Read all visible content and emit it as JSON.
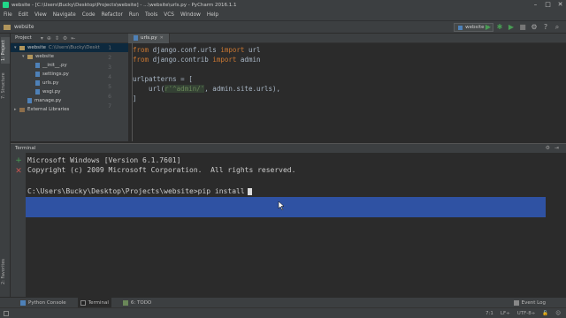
{
  "window": {
    "title": "website - [C:\\Users\\Bucky\\Desktop\\Projects\\website] - ...\\website\\urls.py - PyCharm 2016.1.1",
    "controls": [
      "–",
      "□",
      "✕"
    ]
  },
  "menu": [
    "File",
    "Edit",
    "View",
    "Navigate",
    "Code",
    "Refactor",
    "Run",
    "Tools",
    "VCS",
    "Window",
    "Help"
  ],
  "navbar": {
    "breadcrumb": "website",
    "run_config": "website",
    "accent": "#499c54"
  },
  "left_strip": {
    "tabs": [
      "1: Project",
      "7: Structure",
      "2: Favorites"
    ]
  },
  "project": {
    "header": "Project",
    "tree": [
      {
        "label": "website",
        "path": "C:\\Users\\Bucky\\Deskt",
        "type": "folder",
        "depth": 0,
        "expanded": true,
        "selected": true
      },
      {
        "label": "website",
        "path": "",
        "type": "folder",
        "depth": 1,
        "expanded": true,
        "selected": false
      },
      {
        "label": "__init__.py",
        "path": "",
        "type": "py",
        "depth": 2,
        "selected": false
      },
      {
        "label": "settings.py",
        "path": "",
        "type": "py",
        "depth": 2,
        "selected": false
      },
      {
        "label": "urls.py",
        "path": "",
        "type": "py",
        "depth": 2,
        "selected": false
      },
      {
        "label": "wsgi.py",
        "path": "",
        "type": "py",
        "depth": 2,
        "selected": false
      },
      {
        "label": "manage.py",
        "path": "",
        "type": "py",
        "depth": 1,
        "selected": false
      },
      {
        "label": "External Libraries",
        "path": "",
        "type": "libs",
        "depth": 0,
        "expanded": false,
        "selected": false
      }
    ]
  },
  "editor": {
    "tab": "urls.py",
    "line_numbers": [
      "1",
      "2",
      "3",
      "4",
      "5",
      "6",
      "7"
    ],
    "lines": [
      [
        {
          "t": "from",
          "c": "kw"
        },
        {
          "t": " django.conf.urls ",
          "c": "id"
        },
        {
          "t": "import",
          "c": "kw"
        },
        {
          "t": " url",
          "c": "id"
        }
      ],
      [
        {
          "t": "from",
          "c": "kw"
        },
        {
          "t": " django.contrib ",
          "c": "id"
        },
        {
          "t": "import",
          "c": "kw"
        },
        {
          "t": " admin",
          "c": "id"
        }
      ],
      [],
      [
        {
          "t": "urlpatterns = [",
          "c": "id"
        }
      ],
      [
        {
          "t": "    url(",
          "c": "id"
        },
        {
          "t": "r'^admin/'",
          "c": "str"
        },
        {
          "t": ", admin.site.urls),",
          "c": "id"
        }
      ],
      [
        {
          "t": "]",
          "c": "id"
        }
      ],
      []
    ]
  },
  "terminal": {
    "header": "Terminal",
    "lines": [
      "Microsoft Windows [Version 6.1.7601]",
      "Copyright (c) 2009 Microsoft Corporation.  All rights reserved.",
      "",
      "C:\\Users\\Bucky\\Desktop\\Projects\\website>pip install"
    ],
    "selection_color": "#2f52a3"
  },
  "bottom_bar": {
    "tabs": [
      "Python Console",
      "Terminal",
      "6: TODO"
    ],
    "active": "Terminal",
    "event_log": "Event Log"
  },
  "status": {
    "position": "7:1",
    "line_sep": "LF÷",
    "encoding": "UTF-8÷"
  }
}
